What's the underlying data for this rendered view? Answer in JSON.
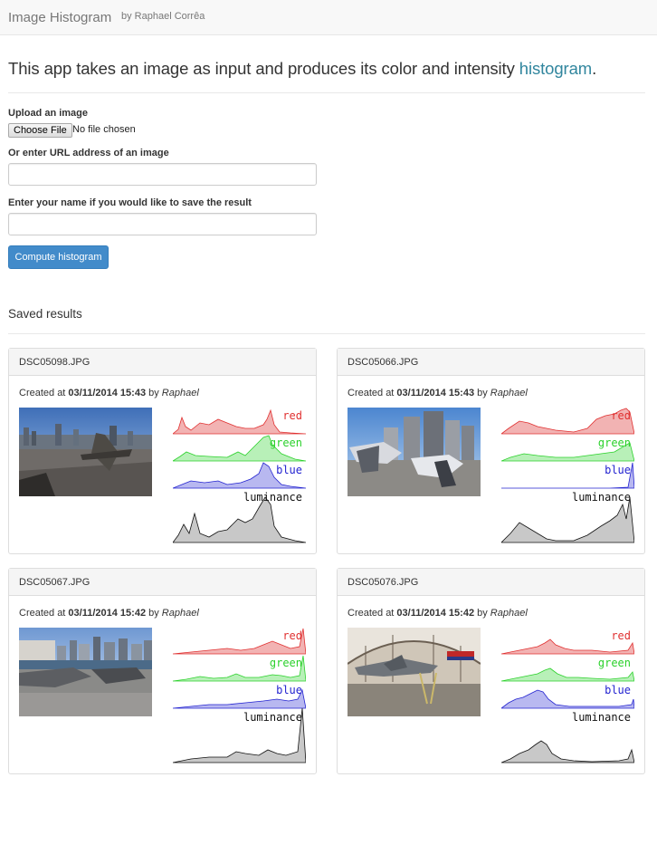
{
  "navbar": {
    "brand": "Image Histogram",
    "byline": "by Raphael Corrêa"
  },
  "intro": {
    "text": "This app takes an image as input and produces its color and intensity ",
    "link": "histogram",
    "end": "."
  },
  "form": {
    "upload_label": "Upload an image",
    "file_button": "Choose File",
    "file_status": "No file chosen",
    "url_label": "Or enter URL address of an image",
    "url_value": "",
    "name_label": "Enter your name if you would like to save the result",
    "name_value": "",
    "submit_label": "Compute histogram"
  },
  "saved_title": "Saved results",
  "histogram_labels": {
    "red": "red",
    "green": "green",
    "blue": "blue",
    "luminance": "luminance"
  },
  "colors": {
    "red_fill": "#f2b3b3",
    "red_line": "#e03030",
    "green_fill": "#b8f0b8",
    "green_line": "#2bd12b",
    "blue_fill": "#b8b8f0",
    "blue_line": "#2323d0",
    "lum_fill": "#c8c8c8",
    "lum_line": "#111111"
  },
  "results": [
    {
      "filename": "DSC05098.JPG",
      "created_prefix": "Created at ",
      "date": "03/11/2014 15:43",
      "by": " by ",
      "author": "Raphael",
      "image": "aircraft-carrier-deck-photo"
    },
    {
      "filename": "DSC05066.JPG",
      "created_prefix": "Created at ",
      "date": "03/11/2014 15:43",
      "by": " by ",
      "author": "Raphael",
      "image": "jets-and-skyscrapers-photo"
    },
    {
      "filename": "DSC05067.JPG",
      "created_prefix": "Created at ",
      "date": "03/11/2014 15:42",
      "by": " by ",
      "author": "Raphael",
      "image": "harbor-skyline-photo"
    },
    {
      "filename": "DSC05076.JPG",
      "created_prefix": "Created at ",
      "date": "03/11/2014 15:42",
      "by": " by ",
      "author": "Raphael",
      "image": "hangar-jet-photo"
    }
  ]
}
